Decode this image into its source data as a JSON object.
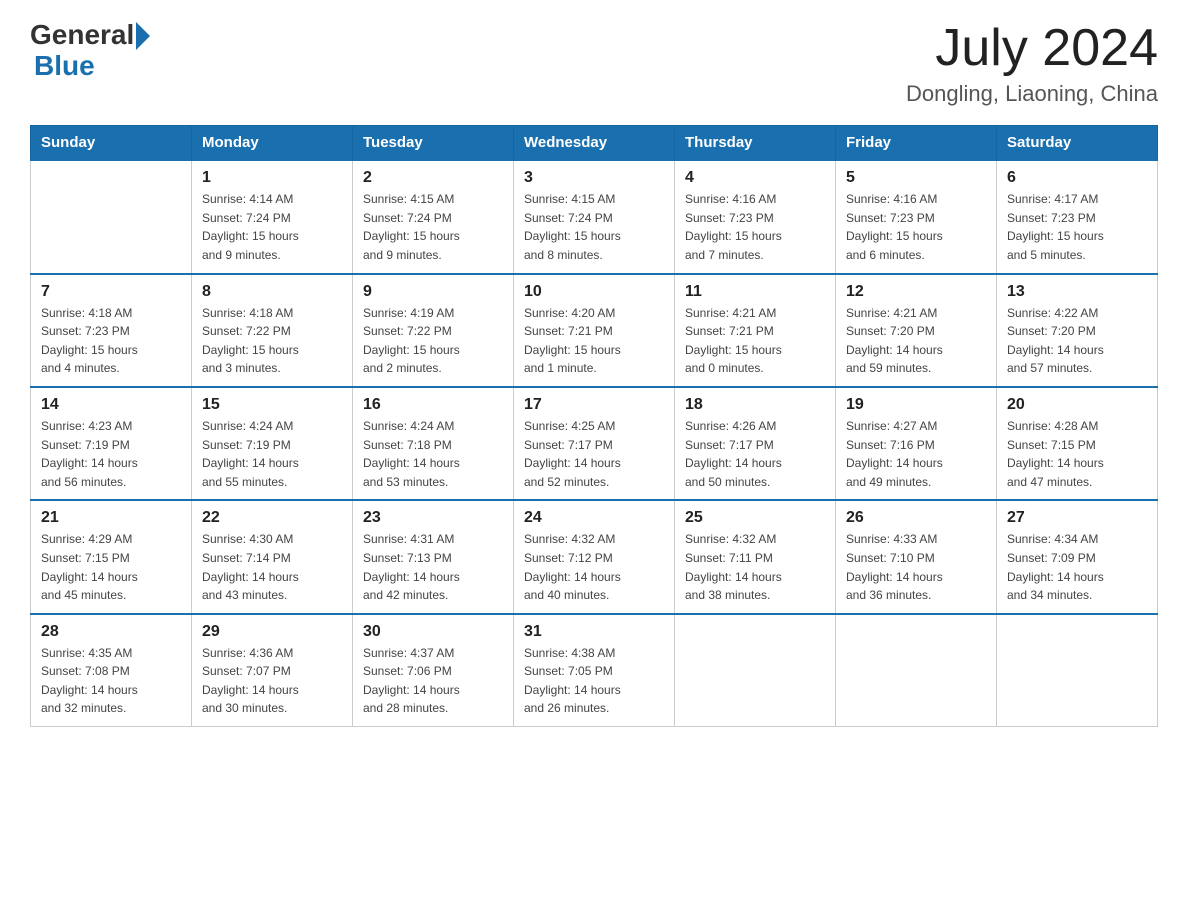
{
  "header": {
    "logo_general": "General",
    "logo_blue": "Blue",
    "month_year": "July 2024",
    "location": "Dongling, Liaoning, China"
  },
  "columns": [
    "Sunday",
    "Monday",
    "Tuesday",
    "Wednesday",
    "Thursday",
    "Friday",
    "Saturday"
  ],
  "weeks": [
    [
      {
        "day": "",
        "info": ""
      },
      {
        "day": "1",
        "info": "Sunrise: 4:14 AM\nSunset: 7:24 PM\nDaylight: 15 hours\nand 9 minutes."
      },
      {
        "day": "2",
        "info": "Sunrise: 4:15 AM\nSunset: 7:24 PM\nDaylight: 15 hours\nand 9 minutes."
      },
      {
        "day": "3",
        "info": "Sunrise: 4:15 AM\nSunset: 7:24 PM\nDaylight: 15 hours\nand 8 minutes."
      },
      {
        "day": "4",
        "info": "Sunrise: 4:16 AM\nSunset: 7:23 PM\nDaylight: 15 hours\nand 7 minutes."
      },
      {
        "day": "5",
        "info": "Sunrise: 4:16 AM\nSunset: 7:23 PM\nDaylight: 15 hours\nand 6 minutes."
      },
      {
        "day": "6",
        "info": "Sunrise: 4:17 AM\nSunset: 7:23 PM\nDaylight: 15 hours\nand 5 minutes."
      }
    ],
    [
      {
        "day": "7",
        "info": "Sunrise: 4:18 AM\nSunset: 7:23 PM\nDaylight: 15 hours\nand 4 minutes."
      },
      {
        "day": "8",
        "info": "Sunrise: 4:18 AM\nSunset: 7:22 PM\nDaylight: 15 hours\nand 3 minutes."
      },
      {
        "day": "9",
        "info": "Sunrise: 4:19 AM\nSunset: 7:22 PM\nDaylight: 15 hours\nand 2 minutes."
      },
      {
        "day": "10",
        "info": "Sunrise: 4:20 AM\nSunset: 7:21 PM\nDaylight: 15 hours\nand 1 minute."
      },
      {
        "day": "11",
        "info": "Sunrise: 4:21 AM\nSunset: 7:21 PM\nDaylight: 15 hours\nand 0 minutes."
      },
      {
        "day": "12",
        "info": "Sunrise: 4:21 AM\nSunset: 7:20 PM\nDaylight: 14 hours\nand 59 minutes."
      },
      {
        "day": "13",
        "info": "Sunrise: 4:22 AM\nSunset: 7:20 PM\nDaylight: 14 hours\nand 57 minutes."
      }
    ],
    [
      {
        "day": "14",
        "info": "Sunrise: 4:23 AM\nSunset: 7:19 PM\nDaylight: 14 hours\nand 56 minutes."
      },
      {
        "day": "15",
        "info": "Sunrise: 4:24 AM\nSunset: 7:19 PM\nDaylight: 14 hours\nand 55 minutes."
      },
      {
        "day": "16",
        "info": "Sunrise: 4:24 AM\nSunset: 7:18 PM\nDaylight: 14 hours\nand 53 minutes."
      },
      {
        "day": "17",
        "info": "Sunrise: 4:25 AM\nSunset: 7:17 PM\nDaylight: 14 hours\nand 52 minutes."
      },
      {
        "day": "18",
        "info": "Sunrise: 4:26 AM\nSunset: 7:17 PM\nDaylight: 14 hours\nand 50 minutes."
      },
      {
        "day": "19",
        "info": "Sunrise: 4:27 AM\nSunset: 7:16 PM\nDaylight: 14 hours\nand 49 minutes."
      },
      {
        "day": "20",
        "info": "Sunrise: 4:28 AM\nSunset: 7:15 PM\nDaylight: 14 hours\nand 47 minutes."
      }
    ],
    [
      {
        "day": "21",
        "info": "Sunrise: 4:29 AM\nSunset: 7:15 PM\nDaylight: 14 hours\nand 45 minutes."
      },
      {
        "day": "22",
        "info": "Sunrise: 4:30 AM\nSunset: 7:14 PM\nDaylight: 14 hours\nand 43 minutes."
      },
      {
        "day": "23",
        "info": "Sunrise: 4:31 AM\nSunset: 7:13 PM\nDaylight: 14 hours\nand 42 minutes."
      },
      {
        "day": "24",
        "info": "Sunrise: 4:32 AM\nSunset: 7:12 PM\nDaylight: 14 hours\nand 40 minutes."
      },
      {
        "day": "25",
        "info": "Sunrise: 4:32 AM\nSunset: 7:11 PM\nDaylight: 14 hours\nand 38 minutes."
      },
      {
        "day": "26",
        "info": "Sunrise: 4:33 AM\nSunset: 7:10 PM\nDaylight: 14 hours\nand 36 minutes."
      },
      {
        "day": "27",
        "info": "Sunrise: 4:34 AM\nSunset: 7:09 PM\nDaylight: 14 hours\nand 34 minutes."
      }
    ],
    [
      {
        "day": "28",
        "info": "Sunrise: 4:35 AM\nSunset: 7:08 PM\nDaylight: 14 hours\nand 32 minutes."
      },
      {
        "day": "29",
        "info": "Sunrise: 4:36 AM\nSunset: 7:07 PM\nDaylight: 14 hours\nand 30 minutes."
      },
      {
        "day": "30",
        "info": "Sunrise: 4:37 AM\nSunset: 7:06 PM\nDaylight: 14 hours\nand 28 minutes."
      },
      {
        "day": "31",
        "info": "Sunrise: 4:38 AM\nSunset: 7:05 PM\nDaylight: 14 hours\nand 26 minutes."
      },
      {
        "day": "",
        "info": ""
      },
      {
        "day": "",
        "info": ""
      },
      {
        "day": "",
        "info": ""
      }
    ]
  ]
}
